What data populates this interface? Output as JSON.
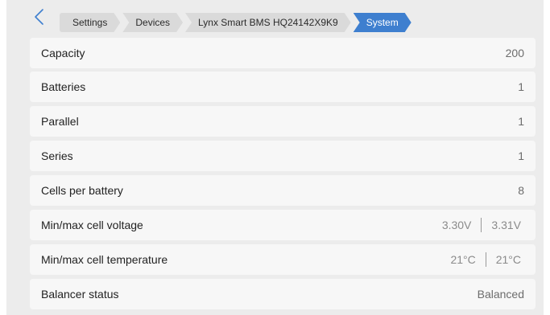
{
  "breadcrumbs": [
    "Settings",
    "Devices",
    "Lynx Smart BMS HQ24142X9K9",
    "System"
  ],
  "rows": [
    {
      "label": "Capacity",
      "value": "200"
    },
    {
      "label": "Batteries",
      "value": "1"
    },
    {
      "label": "Parallel",
      "value": "1"
    },
    {
      "label": "Series",
      "value": "1"
    },
    {
      "label": "Cells per battery",
      "value": "8"
    }
  ],
  "cell_voltage": {
    "label": "Min/max cell voltage",
    "min": "3.30V",
    "max": "3.31V"
  },
  "cell_temperature": {
    "label": "Min/max cell temperature",
    "min": "21°C",
    "max": "21°C"
  },
  "balancer": {
    "label": "Balancer status",
    "value": "Balanced"
  },
  "colors": {
    "accent": "#3e7fcf",
    "row_bg": "#f7f7f7",
    "page_bg": "#ececec"
  },
  "icons": {
    "back": "chevron-left-icon"
  }
}
